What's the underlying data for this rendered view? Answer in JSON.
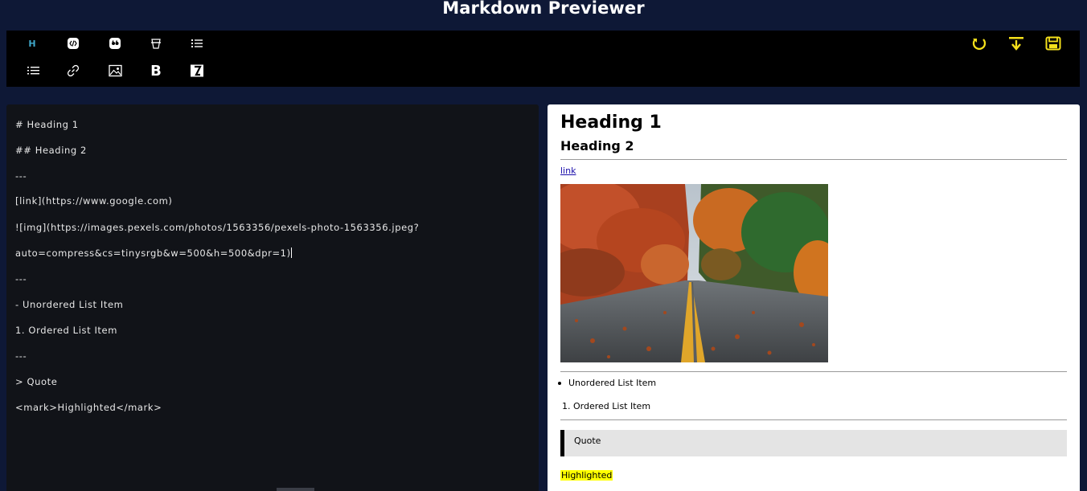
{
  "app": {
    "title": "Markdown Previewer"
  },
  "toolbar": {
    "tools_left": [
      {
        "name": "heading-icon",
        "glyph": "H"
      },
      {
        "name": "code-icon",
        "glyph": ""
      },
      {
        "name": "quote-icon",
        "glyph": ""
      },
      {
        "name": "strikethrough-icon",
        "glyph": ""
      },
      {
        "name": "unordered-list-icon",
        "glyph": ""
      },
      {
        "name": "ordered-list-icon",
        "glyph": ""
      },
      {
        "name": "link-icon",
        "glyph": ""
      },
      {
        "name": "image-icon",
        "glyph": ""
      },
      {
        "name": "bold-icon",
        "glyph": "B"
      },
      {
        "name": "italic-icon",
        "glyph": "I"
      }
    ],
    "tools_right": [
      {
        "name": "reset-icon"
      },
      {
        "name": "download-icon"
      },
      {
        "name": "save-icon"
      }
    ],
    "accent": "#f4e01b",
    "heading_accent": "#3fa7c9"
  },
  "editor": {
    "lines": [
      "# Heading 1",
      "## Heading 2",
      "---",
      "[link](https://www.google.com)",
      "![img](https://images.pexels.com/photos/1563356/pexels-photo-1563356.jpeg?",
      "auto=compress&cs=tinysrgb&w=500&h=500&dpr=1)",
      "---",
      "- Unordered List Item",
      "1. Ordered List Item",
      "---",
      "> Quote",
      "<mark>Highlighted</mark>"
    ]
  },
  "preview": {
    "heading1": "Heading 1",
    "heading2": "Heading 2",
    "link_text": "link",
    "unordered_item": "Unordered List Item",
    "ordered_number": "1.",
    "ordered_item": "Ordered List Item",
    "quote": "Quote",
    "highlighted": "Highlighted",
    "highlight_color": "#ffff00"
  }
}
